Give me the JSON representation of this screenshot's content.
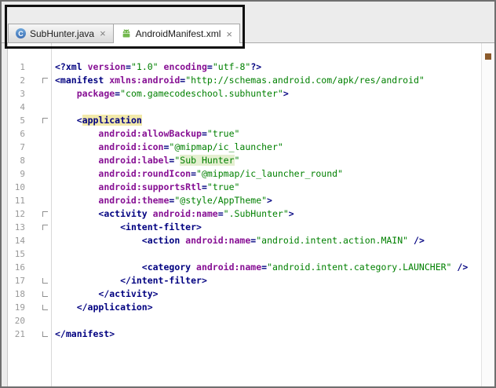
{
  "tab_bar": {
    "tabs": [
      {
        "label": "SubHunter.java",
        "icon": "java-class-icon",
        "icon_letter": "C",
        "close_glyph": "×",
        "active": false
      },
      {
        "label": "AndroidManifest.xml",
        "icon": "android-icon",
        "close_glyph": "×",
        "active": true
      }
    ]
  },
  "annotation": {
    "shape": "rectangle",
    "border_color": "#101010"
  },
  "scrollbar": {
    "inspections_indicator_color": "#8B5A2B"
  },
  "editor": {
    "syntax_colors": {
      "tag": "#000080",
      "attribute": "#871094",
      "value": "#008000",
      "line_number": "#999999",
      "warning_highlight": "#F2E9A9",
      "string_highlight": "#E4EFD0"
    },
    "lines": [
      {
        "n": 1,
        "indent": 0,
        "fold": "",
        "tokens": [
          [
            "tag",
            "<?xml"
          ],
          [
            "plain",
            " "
          ],
          [
            "attr",
            "version"
          ],
          [
            "eq",
            "="
          ],
          [
            "val",
            "\"1.0\""
          ],
          [
            "plain",
            " "
          ],
          [
            "attr",
            "encoding"
          ],
          [
            "eq",
            "="
          ],
          [
            "val",
            "\"utf-8\""
          ],
          [
            "tag",
            "?>"
          ]
        ]
      },
      {
        "n": 2,
        "indent": 0,
        "fold": "start",
        "tokens": [
          [
            "tag",
            "<manifest"
          ],
          [
            "plain",
            " "
          ],
          [
            "attr",
            "xmlns:android"
          ],
          [
            "eq",
            "="
          ],
          [
            "val",
            "\"http://schemas.android.com/apk/res/android\""
          ]
        ]
      },
      {
        "n": 3,
        "indent": 4,
        "fold": "",
        "tokens": [
          [
            "attr",
            "package"
          ],
          [
            "eq",
            "="
          ],
          [
            "val",
            "\"com.gamecodeschool.subhunter\""
          ],
          [
            "tag",
            ">"
          ]
        ]
      },
      {
        "n": 4,
        "indent": 0,
        "fold": "",
        "tokens": []
      },
      {
        "n": 5,
        "indent": 4,
        "fold": "start",
        "tokens": [
          [
            "tag",
            "<"
          ],
          [
            "taghl",
            "application"
          ]
        ]
      },
      {
        "n": 6,
        "indent": 8,
        "fold": "",
        "tokens": [
          [
            "attr",
            "android:allowBackup"
          ],
          [
            "eq",
            "="
          ],
          [
            "val",
            "\"true\""
          ]
        ]
      },
      {
        "n": 7,
        "indent": 8,
        "fold": "",
        "tokens": [
          [
            "attr",
            "android:icon"
          ],
          [
            "eq",
            "="
          ],
          [
            "val",
            "\"@mipmap/ic_launcher\""
          ]
        ]
      },
      {
        "n": 8,
        "indent": 8,
        "fold": "",
        "tokens": [
          [
            "attr",
            "android:label"
          ],
          [
            "eq",
            "="
          ],
          [
            "val",
            "\""
          ],
          [
            "valhl",
            "Sub Hunter"
          ],
          [
            "val",
            "\""
          ]
        ]
      },
      {
        "n": 9,
        "indent": 8,
        "fold": "",
        "tokens": [
          [
            "attr",
            "android:roundIcon"
          ],
          [
            "eq",
            "="
          ],
          [
            "val",
            "\"@mipmap/ic_launcher_round\""
          ]
        ]
      },
      {
        "n": 10,
        "indent": 8,
        "fold": "",
        "tokens": [
          [
            "attr",
            "android:supportsRtl"
          ],
          [
            "eq",
            "="
          ],
          [
            "val",
            "\"true\""
          ]
        ]
      },
      {
        "n": 11,
        "indent": 8,
        "fold": "",
        "tokens": [
          [
            "attr",
            "android:theme"
          ],
          [
            "eq",
            "="
          ],
          [
            "val",
            "\"@style/AppTheme\""
          ],
          [
            "tag",
            ">"
          ]
        ]
      },
      {
        "n": 12,
        "indent": 8,
        "fold": "start",
        "tokens": [
          [
            "tag",
            "<activity"
          ],
          [
            "plain",
            " "
          ],
          [
            "attr",
            "android:name"
          ],
          [
            "eq",
            "="
          ],
          [
            "val",
            "\".SubHunter\""
          ],
          [
            "tag",
            ">"
          ]
        ]
      },
      {
        "n": 13,
        "indent": 12,
        "fold": "start",
        "tokens": [
          [
            "tag",
            "<intent-filter>"
          ]
        ]
      },
      {
        "n": 14,
        "indent": 16,
        "fold": "",
        "tokens": [
          [
            "tag",
            "<action"
          ],
          [
            "plain",
            " "
          ],
          [
            "attr",
            "android:name"
          ],
          [
            "eq",
            "="
          ],
          [
            "val",
            "\"android.intent.action.MAIN\""
          ],
          [
            "plain",
            " "
          ],
          [
            "tag",
            "/>"
          ]
        ]
      },
      {
        "n": 15,
        "indent": 0,
        "fold": "",
        "tokens": []
      },
      {
        "n": 16,
        "indent": 16,
        "fold": "",
        "tokens": [
          [
            "tag",
            "<category"
          ],
          [
            "plain",
            " "
          ],
          [
            "attr",
            "android:name"
          ],
          [
            "eq",
            "="
          ],
          [
            "val",
            "\"android.intent.category.LAUNCHER\""
          ],
          [
            "plain",
            " "
          ],
          [
            "tag",
            "/>"
          ]
        ]
      },
      {
        "n": 17,
        "indent": 12,
        "fold": "end",
        "tokens": [
          [
            "tag",
            "</intent-filter>"
          ]
        ]
      },
      {
        "n": 18,
        "indent": 8,
        "fold": "end",
        "tokens": [
          [
            "tag",
            "</activity>"
          ]
        ]
      },
      {
        "n": 19,
        "indent": 4,
        "fold": "end",
        "tokens": [
          [
            "tag",
            "</application>"
          ]
        ]
      },
      {
        "n": 20,
        "indent": 0,
        "fold": "",
        "tokens": []
      },
      {
        "n": 21,
        "indent": 0,
        "fold": "end",
        "tokens": [
          [
            "tag",
            "</manifest>"
          ]
        ]
      }
    ]
  }
}
